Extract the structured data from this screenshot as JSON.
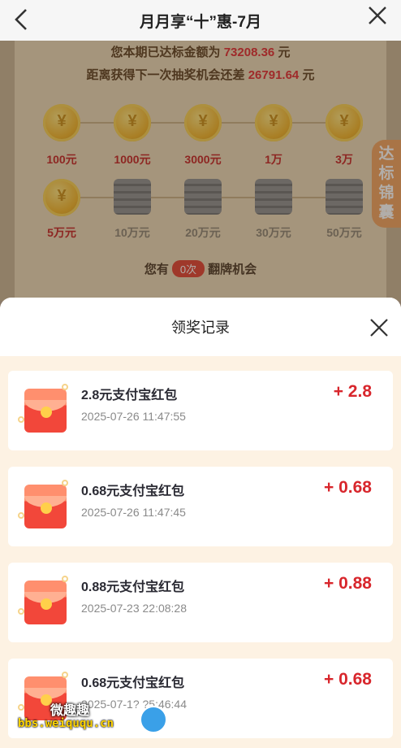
{
  "header": {
    "title": "月月享“十”惠-7月"
  },
  "background": {
    "line1": {
      "prefix": "您本期已达标金额为 ",
      "value": "73208.36",
      "suffix": " 元"
    },
    "line2": {
      "prefix": "距离获得下一次抽奖机会还差 ",
      "value": "26791.64",
      "suffix": " 元"
    },
    "milestones_row1": [
      "100元",
      "1000元",
      "3000元",
      "1万",
      "3万"
    ],
    "milestones_row2": [
      "5万元",
      "10万元",
      "20万元",
      "30万元",
      "50万元"
    ],
    "chance": {
      "prefix": "您有",
      "count": "0次",
      "suffix": "翻牌机会"
    },
    "side_tab": [
      "达",
      "标",
      "锦",
      "囊"
    ]
  },
  "sheet": {
    "title": "领奖记录",
    "records": [
      {
        "name": "2.8元支付宝红包",
        "time": "2025-07-26 11:47:55",
        "amount": "+ 2.8"
      },
      {
        "name": "0.68元支付宝红包",
        "time": "2025-07-26 11:47:45",
        "amount": "+ 0.68"
      },
      {
        "name": "0.88元支付宝红包",
        "time": "2025-07-23 22:08:28",
        "amount": "+ 0.88"
      },
      {
        "name": "0.68元支付宝红包",
        "time": "2025-07-1? ?5:46:44",
        "amount": "+ 0.68"
      }
    ]
  },
  "watermark": {
    "line1": "微趣趣",
    "line2": "bbs.weiququ.cn"
  },
  "colors": {
    "accent_red": "#d8262c",
    "gold": "#f3b324",
    "tab_orange": "#f2a05a"
  },
  "icons": [
    "back-arrow-icon",
    "close-icon",
    "coin-icon",
    "coin-stack-icon",
    "red-envelope-icon"
  ]
}
